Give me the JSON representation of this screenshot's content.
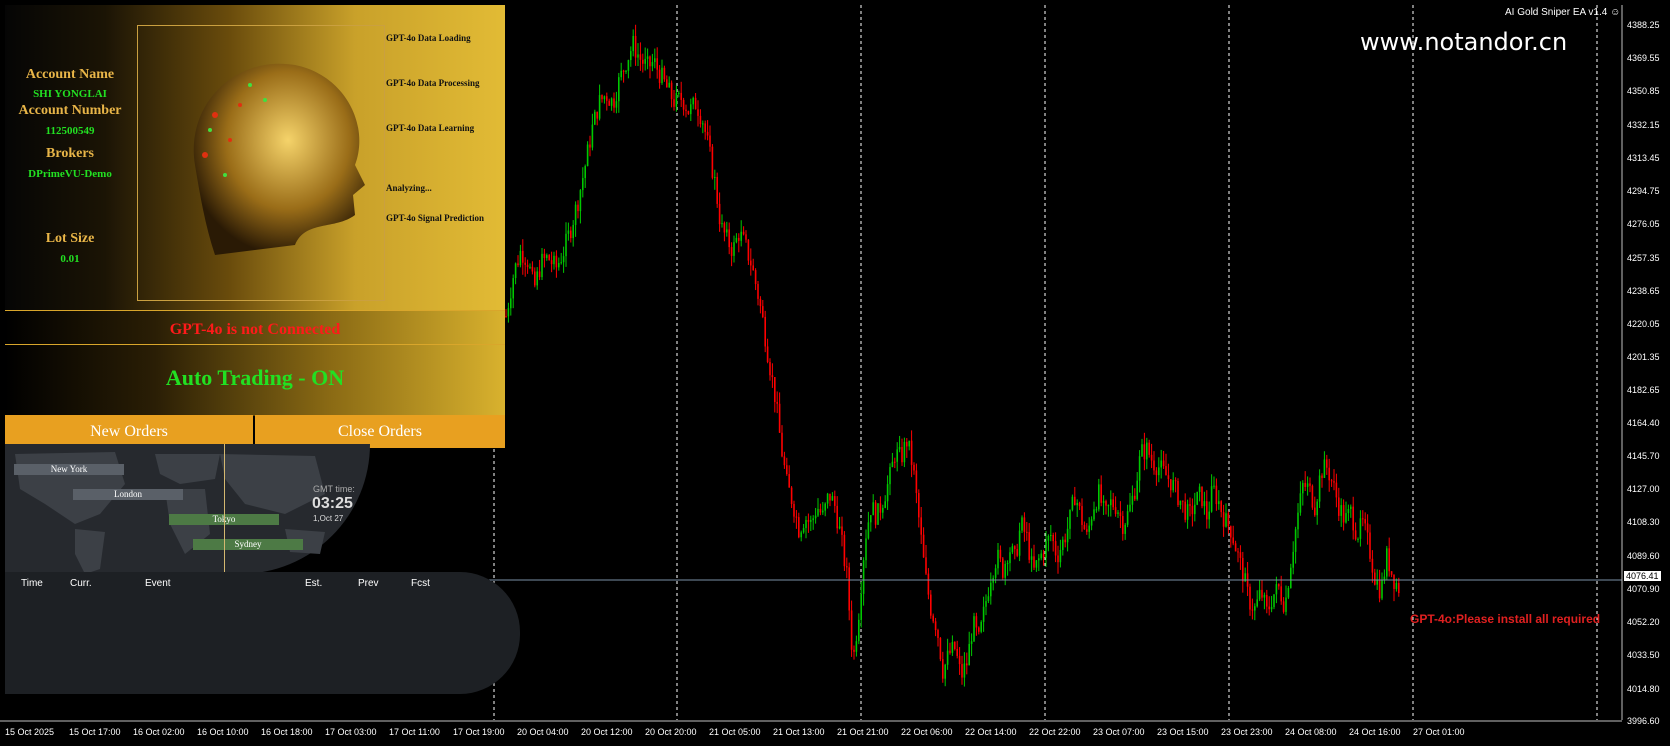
{
  "chart_window": {
    "ea_title": "AI Gold Sniper EA v1.4",
    "watermark": "www.notandor.cn",
    "error_message": "GPT-4o:Please install all required",
    "current_price": "4076.41",
    "colors": {
      "bull": "#00c800",
      "bear": "#ff0000",
      "grid": "#ffffff",
      "bg": "#000000"
    }
  },
  "ea_panel": {
    "account_name_label": "Account Name",
    "account_name": "SHI YONGLAI",
    "account_number_label": "Account Number",
    "account_number": "112500549",
    "brokers_label": "Brokers",
    "broker": "DPrimeVU-Demo",
    "lot_size_label": "Lot Size",
    "lot_size": "0.01",
    "steps": [
      "GPT-4o Data Loading",
      "GPT-4o Data Processing",
      "GPT-4o Data Learning",
      "Analyzing...",
      "GPT-4o Signal Prediction"
    ],
    "gpt_status": "GPT-4o is not Connected",
    "auto_trading": "Auto Trading - ON",
    "new_orders": "New Orders",
    "close_orders": "Close Orders"
  },
  "sessions": {
    "names": [
      "New York",
      "London",
      "Tokyo",
      "Sydney"
    ],
    "gmt_label": "GMT time:",
    "gmt_time": "03:25",
    "gmt_date": "1,Oct 27"
  },
  "calendar": {
    "headers": [
      "Time",
      "Curr.",
      "Event",
      "Est.",
      "Prev",
      "Fcst"
    ]
  },
  "chart_data": {
    "type": "candlestick",
    "title": "",
    "y_ticks": [
      "4388.25",
      "4369.55",
      "4350.85",
      "4332.15",
      "4313.45",
      "4294.75",
      "4276.05",
      "4257.35",
      "4238.65",
      "4220.05",
      "4201.35",
      "4182.65",
      "4164.40",
      "4145.70",
      "4127.00",
      "4108.30",
      "4089.60",
      "4070.90",
      "4052.20",
      "4033.50",
      "4014.80",
      "3996.60"
    ],
    "x_ticks": [
      "15 Oct 2025",
      "15 Oct 17:00",
      "16 Oct 02:00",
      "16 Oct 10:00",
      "16 Oct 18:00",
      "17 Oct 03:00",
      "17 Oct 11:00",
      "17 Oct 19:00",
      "20 Oct 04:00",
      "20 Oct 12:00",
      "20 Oct 20:00",
      "21 Oct 05:00",
      "21 Oct 13:00",
      "21 Oct 21:00",
      "22 Oct 06:00",
      "22 Oct 14:00",
      "22 Oct 22:00",
      "23 Oct 07:00",
      "23 Oct 15:00",
      "23 Oct 23:00",
      "24 Oct 08:00",
      "24 Oct 16:00",
      "27 Oct 01:00"
    ],
    "ylim": [
      3996.6,
      4388.25
    ],
    "current_price": 4076.41,
    "close_path": [
      [
        0,
        4225
      ],
      [
        8,
        4250
      ],
      [
        15,
        4262
      ],
      [
        22,
        4256
      ],
      [
        28,
        4240
      ],
      [
        35,
        4255
      ],
      [
        42,
        4258
      ],
      [
        50,
        4252
      ],
      [
        58,
        4262
      ],
      [
        65,
        4275
      ],
      [
        72,
        4290
      ],
      [
        80,
        4312
      ],
      [
        86,
        4330
      ],
      [
        93,
        4345
      ],
      [
        100,
        4350
      ],
      [
        107,
        4345
      ],
      [
        113,
        4357
      ],
      [
        120,
        4368
      ],
      [
        127,
        4378
      ],
      [
        134,
        4370
      ],
      [
        141,
        4365
      ],
      [
        148,
        4368
      ],
      [
        155,
        4360
      ],
      [
        162,
        4352
      ],
      [
        169,
        4345
      ],
      [
        176,
        4348
      ],
      [
        183,
        4340
      ],
      [
        190,
        4345
      ],
      [
        197,
        4335
      ],
      [
        203,
        4318
      ],
      [
        209,
        4300
      ],
      [
        215,
        4275
      ],
      [
        221,
        4268
      ],
      [
        227,
        4262
      ],
      [
        233,
        4272
      ],
      [
        239,
        4265
      ],
      [
        245,
        4255
      ],
      [
        251,
        4240
      ],
      [
        257,
        4222
      ],
      [
        263,
        4200
      ],
      [
        269,
        4180
      ],
      [
        275,
        4152
      ],
      [
        281,
        4130
      ],
      [
        287,
        4120
      ],
      [
        293,
        4105
      ],
      [
        299,
        4112
      ],
      [
        305,
        4108
      ],
      [
        311,
        4118
      ],
      [
        317,
        4112
      ],
      [
        323,
        4125
      ],
      [
        329,
        4118
      ],
      [
        335,
        4100
      ],
      [
        341,
        4078
      ],
      [
        347,
        4030
      ],
      [
        353,
        4060
      ],
      [
        359,
        4100
      ],
      [
        365,
        4118
      ],
      [
        371,
        4112
      ],
      [
        377,
        4122
      ],
      [
        383,
        4132
      ],
      [
        389,
        4148
      ],
      [
        395,
        4145
      ],
      [
        401,
        4155
      ],
      [
        407,
        4140
      ],
      [
        413,
        4110
      ],
      [
        419,
        4080
      ],
      [
        425,
        4060
      ],
      [
        431,
        4050
      ],
      [
        437,
        4025
      ],
      [
        443,
        4035
      ],
      [
        449,
        4038
      ],
      [
        455,
        4022
      ],
      [
        461,
        4030
      ],
      [
        467,
        4052
      ],
      [
        473,
        4042
      ],
      [
        479,
        4062
      ],
      [
        485,
        4080
      ],
      [
        491,
        4090
      ],
      [
        497,
        4082
      ],
      [
        503,
        4095
      ],
      [
        509,
        4088
      ],
      [
        515,
        4108
      ],
      [
        521,
        4100
      ],
      [
        527,
        4080
      ],
      [
        533,
        4088
      ],
      [
        539,
        4095
      ],
      [
        545,
        4102
      ],
      [
        551,
        4090
      ],
      [
        557,
        4098
      ],
      [
        563,
        4108
      ],
      [
        569,
        4125
      ],
      [
        575,
        4112
      ],
      [
        581,
        4100
      ],
      [
        587,
        4118
      ],
      [
        593,
        4125
      ],
      [
        599,
        4112
      ],
      [
        605,
        4120
      ],
      [
        611,
        4118
      ],
      [
        617,
        4108
      ],
      [
        623,
        4115
      ],
      [
        629,
        4128
      ],
      [
        635,
        4148
      ],
      [
        641,
        4150
      ],
      [
        647,
        4143
      ],
      [
        653,
        4140
      ],
      [
        659,
        4136
      ],
      [
        665,
        4132
      ],
      [
        671,
        4125
      ],
      [
        677,
        4118
      ],
      [
        683,
        4112
      ],
      [
        689,
        4120
      ],
      [
        695,
        4125
      ],
      [
        701,
        4112
      ],
      [
        707,
        4128
      ],
      [
        713,
        4120
      ],
      [
        719,
        4110
      ],
      [
        725,
        4105
      ],
      [
        731,
        4092
      ],
      [
        737,
        4080
      ],
      [
        743,
        4065
      ],
      [
        749,
        4060
      ],
      [
        755,
        4070
      ],
      [
        761,
        4058
      ],
      [
        767,
        4068
      ],
      [
        773,
        4072
      ],
      [
        779,
        4062
      ],
      [
        785,
        4088
      ],
      [
        791,
        4110
      ],
      [
        797,
        4130
      ],
      [
        803,
        4128
      ],
      [
        809,
        4118
      ],
      [
        815,
        4138
      ],
      [
        821,
        4140
      ],
      [
        827,
        4130
      ],
      [
        833,
        4118
      ],
      [
        839,
        4110
      ],
      [
        845,
        4115
      ],
      [
        851,
        4102
      ],
      [
        857,
        4108
      ],
      [
        863,
        4095
      ],
      [
        869,
        4078
      ],
      [
        875,
        4070
      ],
      [
        881,
        4090
      ],
      [
        887,
        4078
      ],
      [
        893,
        4072
      ]
    ]
  }
}
